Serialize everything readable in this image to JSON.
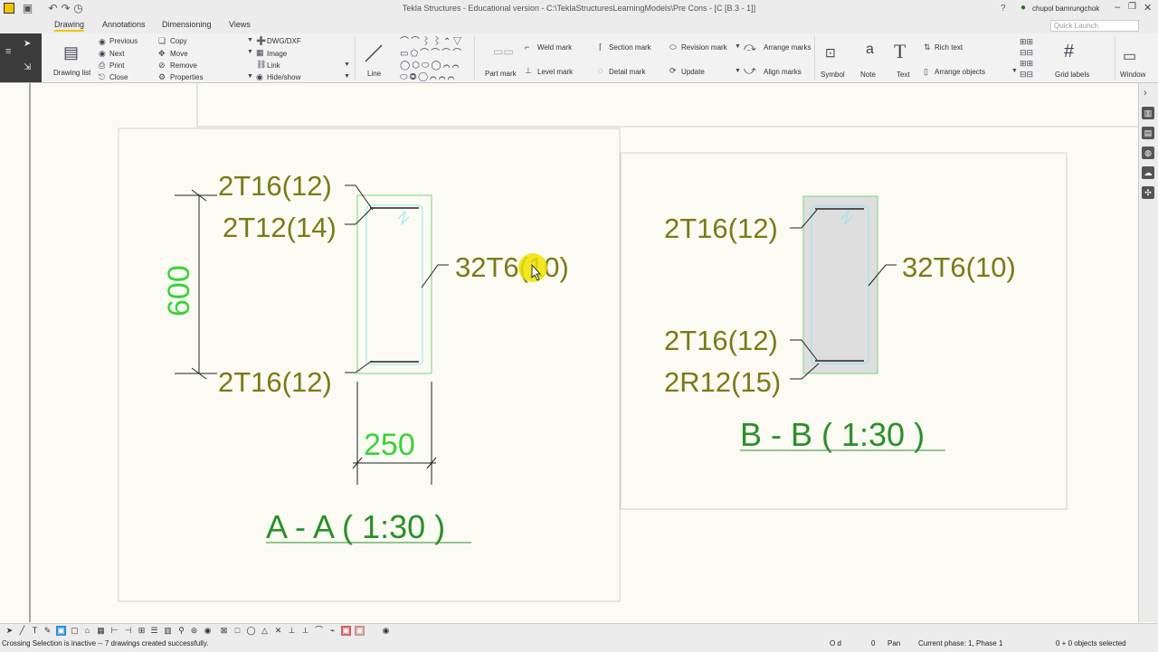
{
  "window": {
    "title": "Tekla Structures - Educational version - C:\\TeklaStructuresLearningModels\\Pre Cons - [C  [B.3 - 1]]",
    "user": "chupol bamrungchok",
    "help_icon": "?"
  },
  "tabs": [
    {
      "label": "Drawing",
      "active": true
    },
    {
      "label": "Annotations",
      "active": false
    },
    {
      "label": "Dimensioning",
      "active": false
    },
    {
      "label": "Views",
      "active": false
    }
  ],
  "quick_launch": {
    "placeholder": "Quick Launch"
  },
  "ribbon": {
    "drawing_list": "Drawing list",
    "nav": [
      "Previous",
      "Next",
      "Print",
      "Close"
    ],
    "edit": [
      "Copy",
      "Move",
      "Remove",
      "Properties"
    ],
    "insert": [
      "DWG/DXF",
      "Image",
      "Link",
      "Hide/show"
    ],
    "line": "Line",
    "marks": {
      "part_mark": "Part mark",
      "weld_mark": "Weld mark",
      "level_mark": "Level mark",
      "section_mark": "Section mark",
      "detail_mark": "Detail mark",
      "revision_mark": "Revision mark",
      "update": "Update",
      "arrange_marks": "Arrange marks",
      "align_marks": "Align marks"
    },
    "symbol": "Symbol",
    "note": "Note",
    "text": "Text",
    "rich_text": "Rich text",
    "arrange_objects": "Arrange objects",
    "grid_labels": "Grid labels",
    "window": "Window"
  },
  "view_a": {
    "title": "A - A ( 1:30 )",
    "marks": [
      "2T16(12)",
      "2T12(14)",
      "32T6(10)",
      "2T16(12)"
    ],
    "dim_height": "600",
    "dim_width": "250"
  },
  "view_b": {
    "title": "B - B ( 1:30 )",
    "marks": [
      "2T16(12)",
      "32T6(10)",
      "2T16(12)",
      "2R12(15)"
    ]
  },
  "status": {
    "message": "Crossing Selection is inactive -- 7 drawings created successfully.",
    "od": "O d",
    "zero": "0",
    "mode": "Pan",
    "phase": "Current phase: 1, Phase 1",
    "selected": "0 + 0 objects selected"
  },
  "colors": {
    "mark_text": "#7a7a16",
    "dimension_text": "#39d239",
    "view_title": "#2a8f2a",
    "accent": "#f2c400"
  }
}
